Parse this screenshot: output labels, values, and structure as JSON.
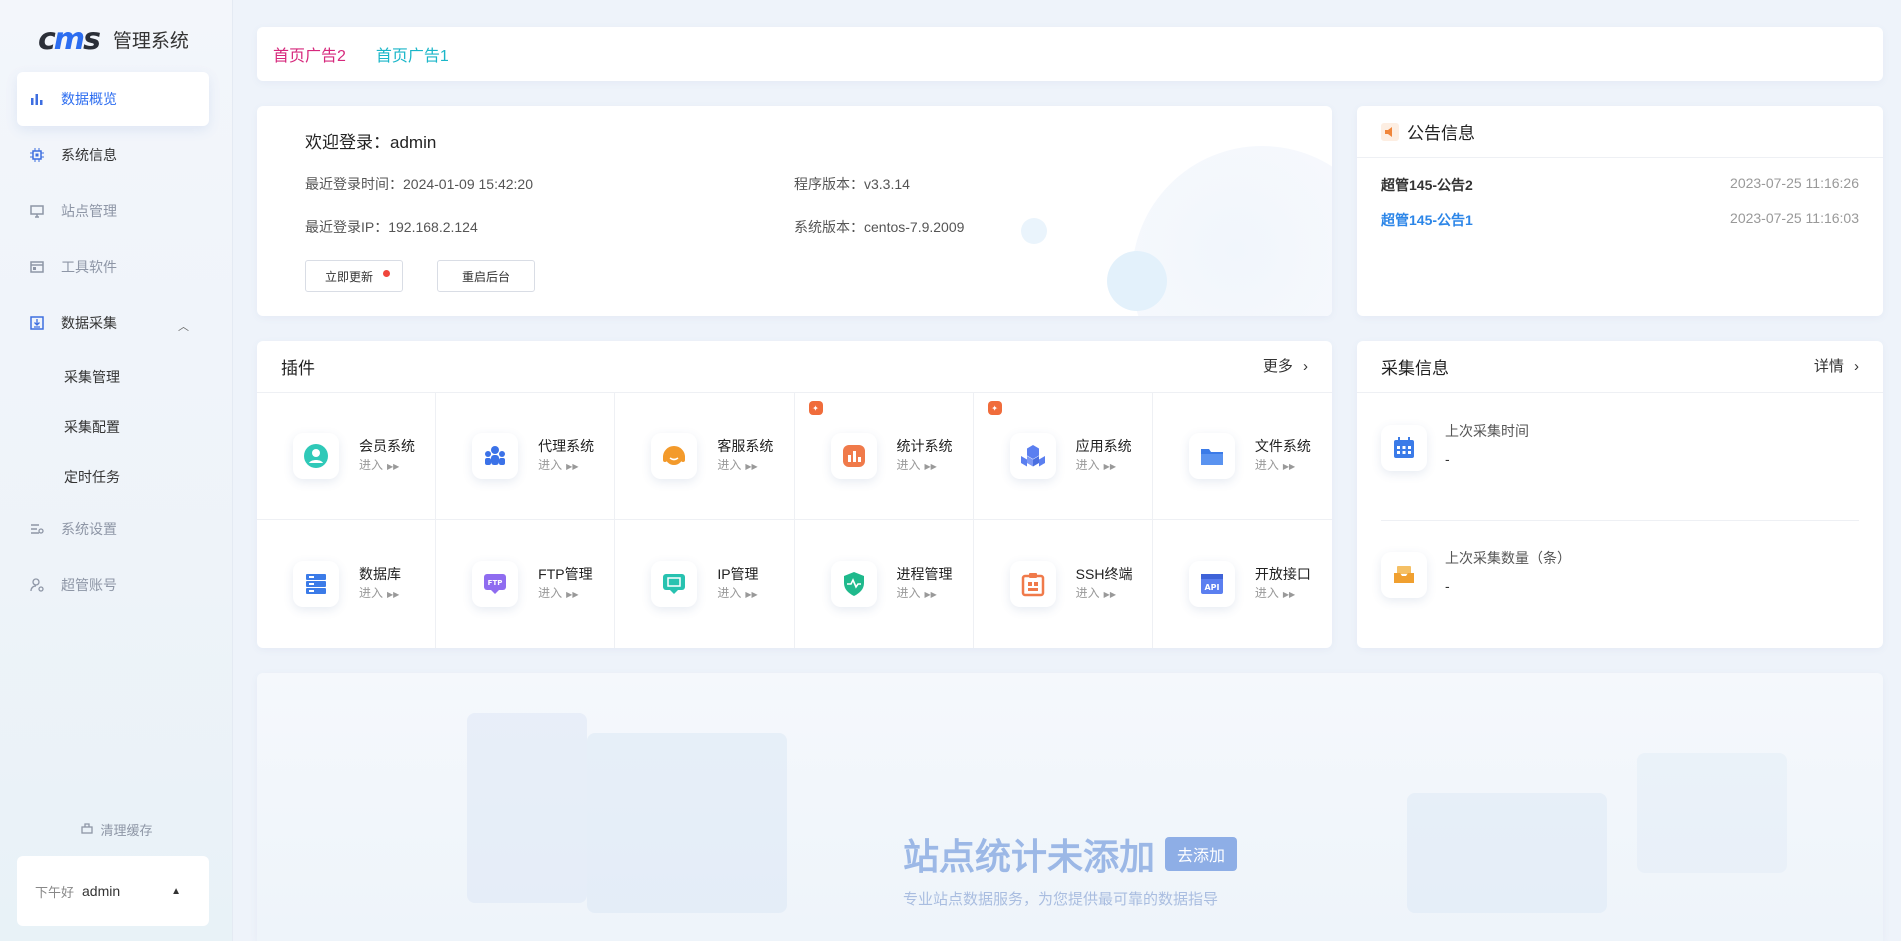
{
  "sidebar": {
    "logo_mark": "cms",
    "logo_text": "管理系统",
    "items": [
      {
        "label": "数据概览",
        "icon": "bar-chart-icon"
      },
      {
        "label": "系统信息",
        "icon": "chip-icon"
      },
      {
        "label": "站点管理",
        "icon": "monitor-icon"
      },
      {
        "label": "工具软件",
        "icon": "window-icon"
      },
      {
        "label": "数据采集",
        "icon": "download-box-icon"
      },
      {
        "label": "系统设置",
        "icon": "settings-list-icon"
      },
      {
        "label": "超管账号",
        "icon": "user-gear-icon"
      }
    ],
    "sub_items": [
      "采集管理",
      "采集配置",
      "定时任务"
    ],
    "clear_cache": "清理缓存",
    "greeting": "下午好",
    "username": "admin"
  },
  "ads": {
    "ad1": "首页广告2",
    "ad2": "首页广告1"
  },
  "welcome": {
    "title": "欢迎登录：admin",
    "last_login_time": "最近登录时间：2024-01-09 15:42:20",
    "program_version": "程序版本：v3.3.14",
    "last_login_ip": "最近登录IP：192.168.2.124",
    "system_version": "系统版本：centos-7.9.2009",
    "update_btn": "立即更新",
    "restart_btn": "重启后台"
  },
  "notice": {
    "title": "公告信息",
    "items": [
      {
        "title": "超管145-公告2",
        "date": "2023-07-25 11:16:26"
      },
      {
        "title": "超管145-公告1",
        "date": "2023-07-25 11:16:03"
      }
    ]
  },
  "plugins": {
    "title": "插件",
    "more": "更多",
    "enter": "进入",
    "items": [
      {
        "name": "会员系统",
        "icon": "user-circle-icon",
        "color": "#2fc9b8"
      },
      {
        "name": "代理系统",
        "icon": "group-icon",
        "color": "#3b72e8"
      },
      {
        "name": "客服系统",
        "icon": "headset-icon",
        "color": "#f39a2b"
      },
      {
        "name": "统计系统",
        "icon": "stats-icon",
        "color": "#f07a4a"
      },
      {
        "name": "应用系统",
        "icon": "cubes-icon",
        "color": "#5b7ff0"
      },
      {
        "name": "文件系统",
        "icon": "folder-icon",
        "color": "#3b7be8"
      },
      {
        "name": "数据库",
        "icon": "database-icon",
        "color": "#3b7be8"
      },
      {
        "name": "FTP管理",
        "icon": "ftp-icon",
        "color": "#8f6cf0"
      },
      {
        "name": "IP管理",
        "icon": "ip-icon",
        "color": "#27c2b0"
      },
      {
        "name": "进程管理",
        "icon": "shield-pulse-icon",
        "color": "#1fb98c"
      },
      {
        "name": "SSH终端",
        "icon": "clipboard-icon",
        "color": "#f07a4a"
      },
      {
        "name": "开放接口",
        "icon": "api-icon",
        "color": "#5b7ff0"
      }
    ]
  },
  "collect": {
    "title": "采集信息",
    "detail": "详情",
    "last_time_label": "上次采集时间",
    "last_time_value": "-",
    "last_count_label": "上次采集数量（条）",
    "last_count_value": "-"
  },
  "stats": {
    "empty_title": "站点统计未添加",
    "add_btn": "去添加",
    "subtitle": "专业站点数据服务，为您提供最可靠的数据指导"
  }
}
